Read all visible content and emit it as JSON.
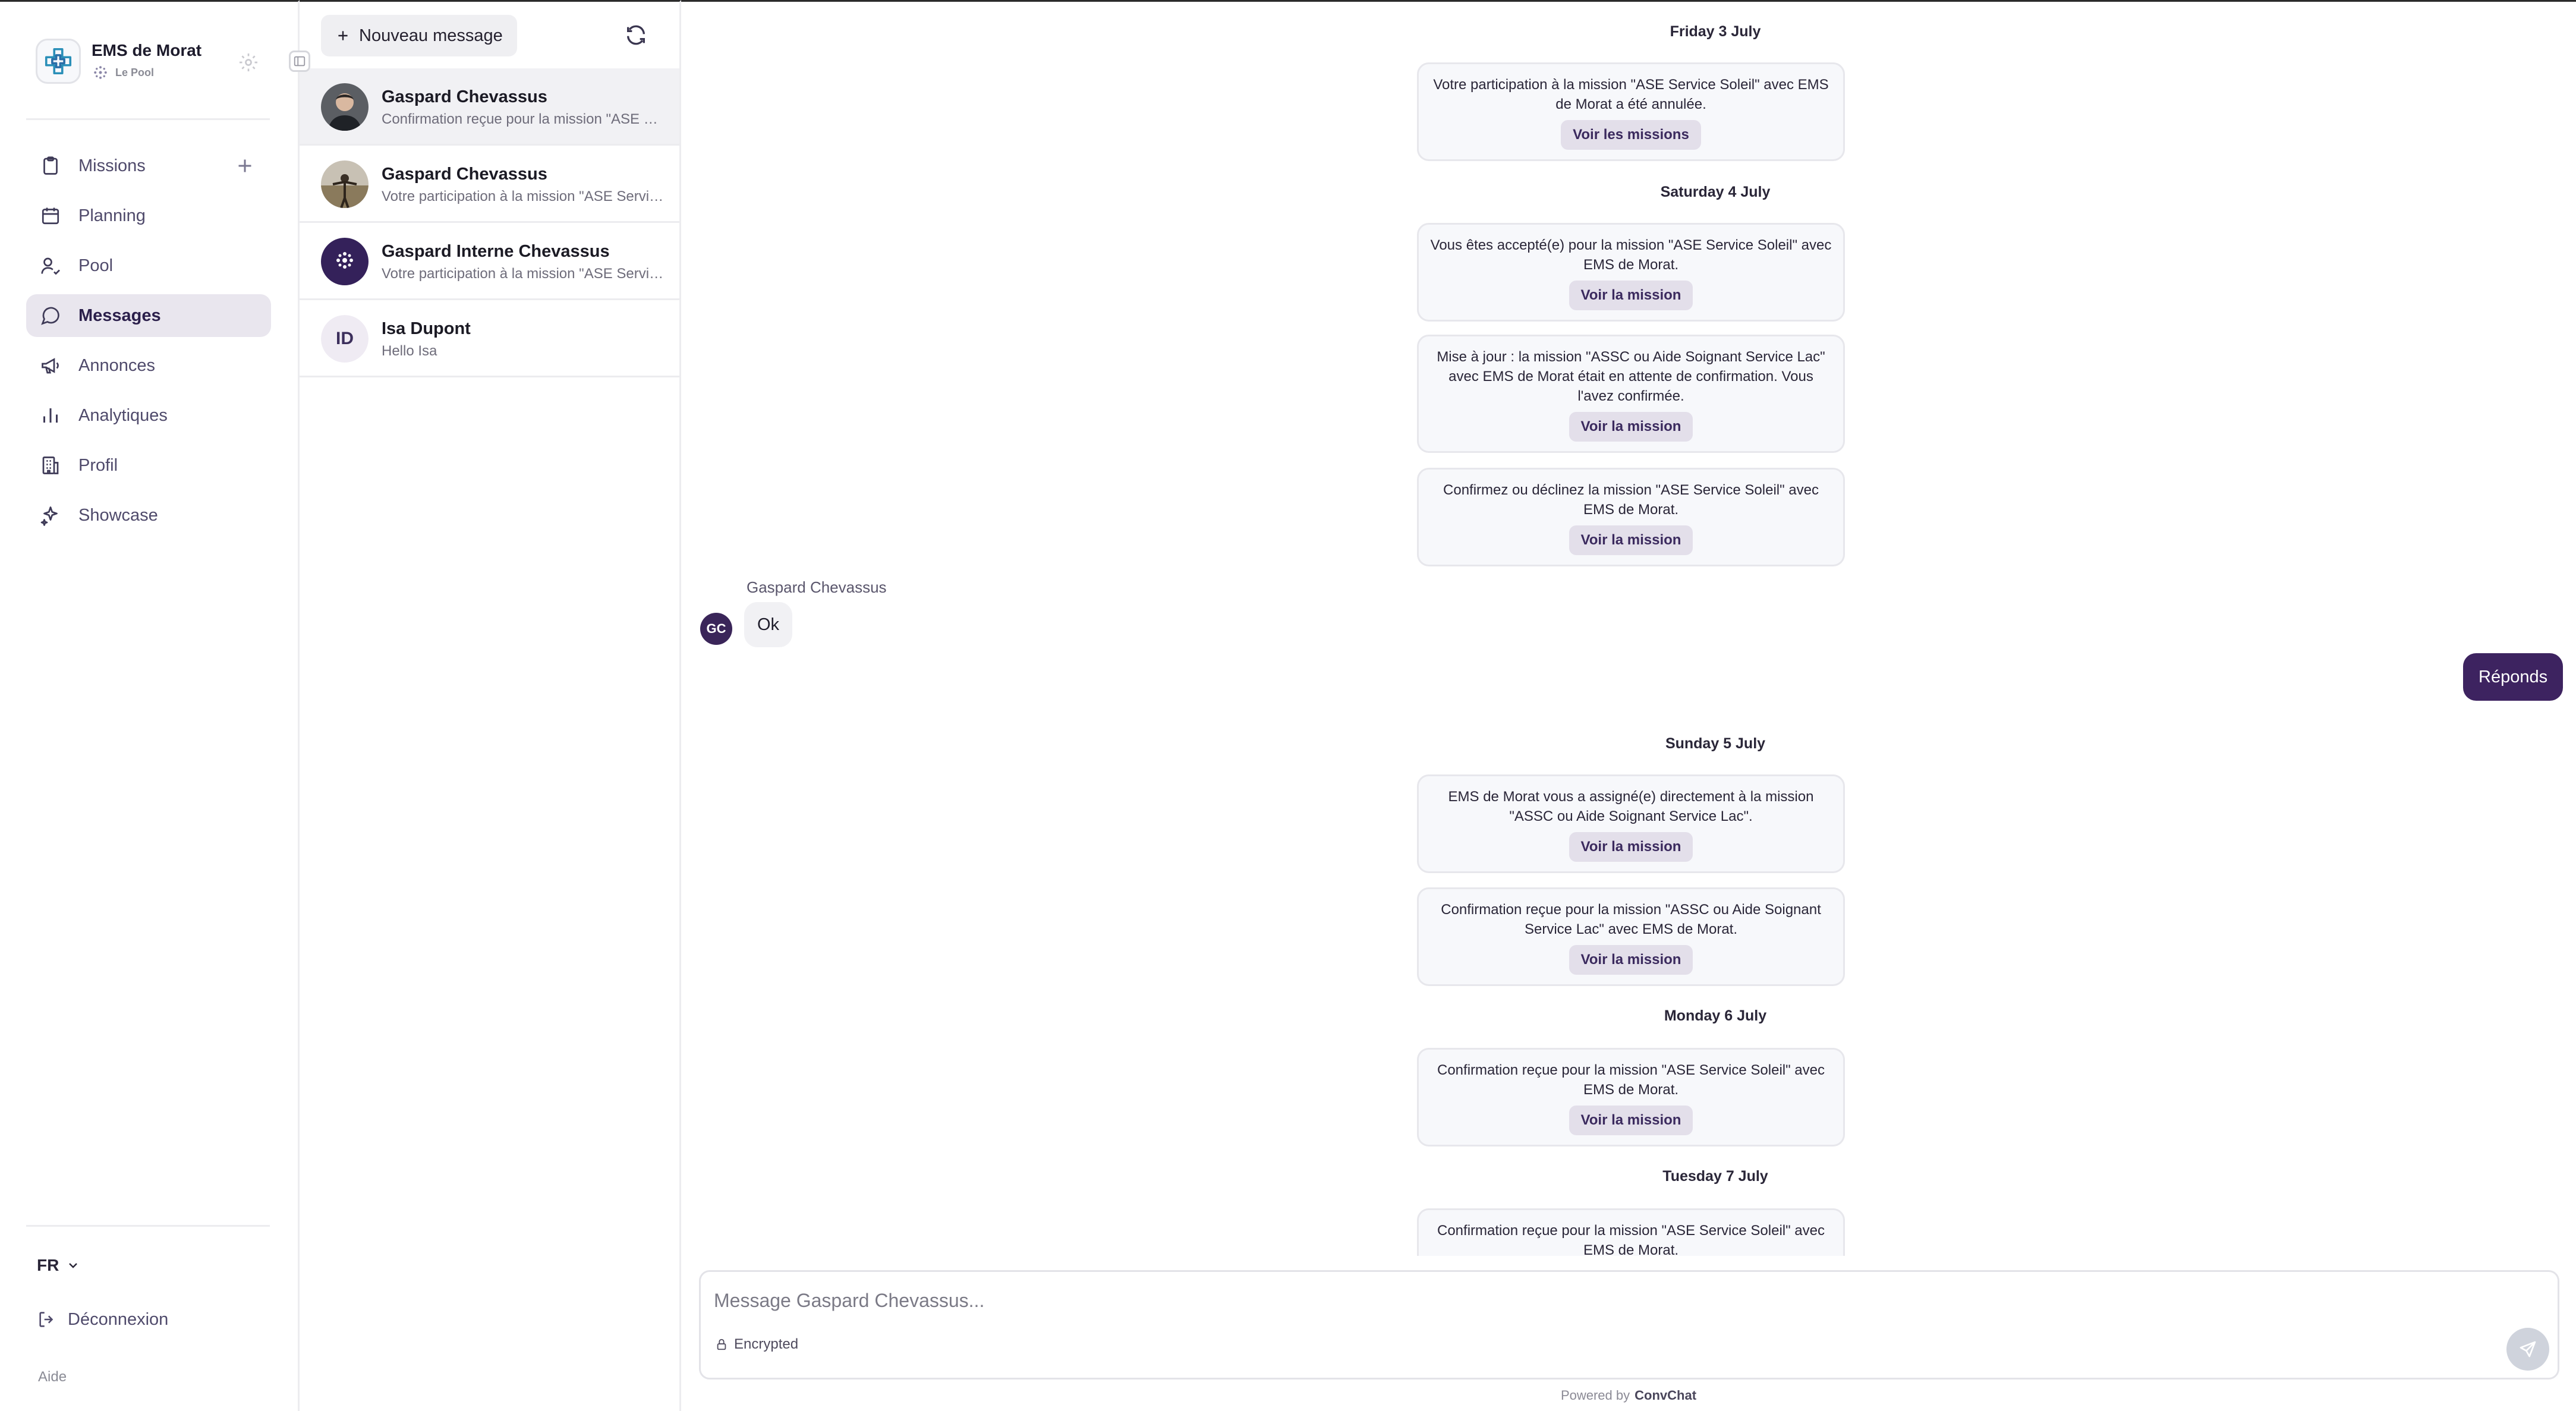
{
  "org": {
    "name": "EMS de Morat",
    "subtitle": "Le Pool"
  },
  "nav": {
    "items": [
      {
        "label": "Missions",
        "icon": "clipboard-icon"
      },
      {
        "label": "Planning",
        "icon": "calendar-icon"
      },
      {
        "label": "Pool",
        "icon": "user-check-icon"
      },
      {
        "label": "Messages",
        "icon": "message-circle-icon",
        "active": true
      },
      {
        "label": "Annonces",
        "icon": "megaphone-icon"
      },
      {
        "label": "Analytiques",
        "icon": "bar-chart-icon"
      },
      {
        "label": "Profil",
        "icon": "building-icon"
      },
      {
        "label": "Showcase",
        "icon": "sparkles-icon"
      }
    ],
    "language": "FR",
    "logout": "Déconnexion",
    "help": "Aide"
  },
  "conversations": {
    "new_message": "Nouveau message",
    "items": [
      {
        "name": "Gaspard Chevassus",
        "preview": "Confirmation reçue pour la mission \"ASE Service Soleil\" avec EMS de Morat.",
        "avatar": "photo-avatar-dark",
        "active": true
      },
      {
        "name": "Gaspard Chevassus",
        "preview": "Votre participation à la mission \"ASE Service Soleil\" avec EMS de Morat a été annulée.",
        "avatar": "photo-avatar-landscape"
      },
      {
        "name": "Gaspard Interne Chevassus",
        "preview": "Votre participation à la mission \"ASE Service Soleil\" avec EMS de Morat a été annulée.",
        "avatar": "logo-avatar-pool"
      },
      {
        "name": "Isa Dupont",
        "preview": "Hello Isa",
        "initials": "ID"
      }
    ]
  },
  "chat": {
    "dates": {
      "d1": "Friday 3 July",
      "d2": "Saturday 4 July",
      "d3": "Sunday 5 July",
      "d4": "Monday 6 July",
      "d5": "Tuesday 7 July"
    },
    "cards": [
      {
        "text": "Votre participation à la mission \"ASE Service Soleil\" avec EMS de Morat a été annulée.",
        "button": "Voir les missions"
      },
      {
        "text": "Vous êtes accepté(e) pour la mission \"ASE Service Soleil\" avec EMS de Morat.",
        "button": "Voir la mission"
      },
      {
        "text": "Mise à jour : la mission \"ASSC ou Aide Soignant Service Lac\" avec EMS de Morat était en attente de confirmation. Vous l'avez confirmée.",
        "button": "Voir la mission"
      },
      {
        "text": "Confirmez ou déclinez la mission \"ASE Service Soleil\" avec EMS de Morat.",
        "button": "Voir la mission"
      },
      {
        "text": "EMS de Morat vous a assigné(e) directement à la mission \"ASSC ou Aide Soignant Service Lac\".",
        "button": "Voir la mission"
      },
      {
        "text": "Confirmation reçue pour la mission \"ASSC ou Aide Soignant Service Lac\" avec EMS de Morat.",
        "button": "Voir la mission"
      },
      {
        "text": "Confirmation reçue pour la mission \"ASE Service Soleil\" avec EMS de Morat.",
        "button": "Voir la mission"
      },
      {
        "text": "Confirmation reçue pour la mission \"ASE Service Soleil\" avec EMS de Morat."
      }
    ],
    "incoming": {
      "sender": "Gaspard Chevassus",
      "initials": "GC",
      "text": "Ok"
    },
    "outgoing": {
      "text": "Réponds"
    },
    "composer": {
      "placeholder": "Message Gaspard Chevassus...",
      "encrypted": "Encrypted"
    },
    "powered_by": "Powered by",
    "brand": "ConvChat"
  },
  "colors": {
    "accent": "#3d2360",
    "active_nav": "#e9e6ee",
    "card_bg": "#f7f8fb",
    "card_button": "#e3dfea"
  }
}
